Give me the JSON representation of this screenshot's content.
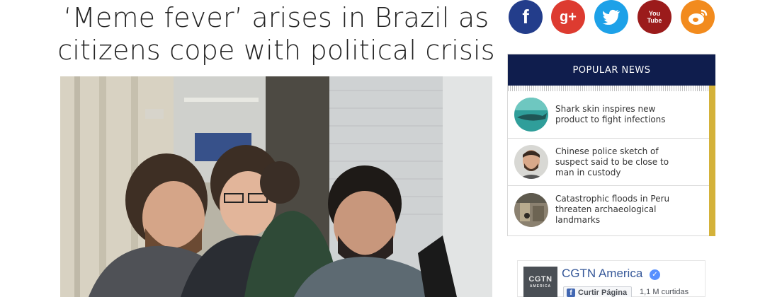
{
  "article": {
    "title": "‘Meme fever’ arises in Brazil as citizens cope with political crisis"
  },
  "social": [
    {
      "icon": "facebook-icon",
      "glyph": "f",
      "color": "#233d8b"
    },
    {
      "icon": "google-plus-icon",
      "glyph": "g+",
      "color": "#dd3b30"
    },
    {
      "icon": "twitter-icon",
      "glyph": "twitter",
      "color": "#1da1e8"
    },
    {
      "icon": "youtube-icon",
      "glyph": "You Tube",
      "color": "#9b1b1b"
    },
    {
      "icon": "weibo-icon",
      "glyph": "weibo",
      "color": "#f28b1e"
    }
  ],
  "popular": {
    "header": "POPULAR NEWS",
    "accent_color": "#d4b23a",
    "header_color": "#0f1d4d",
    "items": [
      {
        "title": "Shark skin inspires new product to fight infections",
        "thumb_icon": "shark-thumbnail"
      },
      {
        "title": "Chinese police sketch of suspect said to be close to man in custody",
        "thumb_icon": "sketch-portrait-thumbnail"
      },
      {
        "title": "Catastrophic floods in Peru threaten archaeological landmarks",
        "thumb_icon": "peru-landmark-thumbnail"
      }
    ]
  },
  "facebook": {
    "logo_text": "CGTN",
    "logo_subtext": "AMERICA",
    "page_name": "CGTN America",
    "like_label": "Curtir Página",
    "like_count": "1,1 M curtidas"
  }
}
